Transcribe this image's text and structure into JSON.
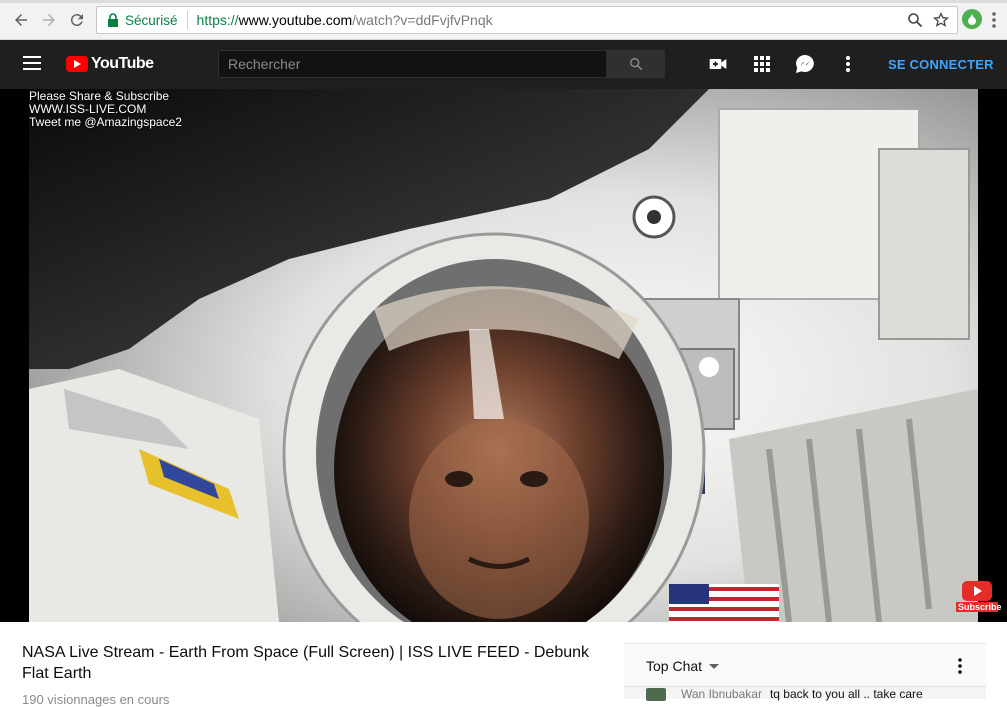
{
  "browser": {
    "secure_label": "Sécurisé",
    "url_scheme": "https://",
    "url_host": "www.youtube.com",
    "url_path": "/watch?v=ddFvjfvPnqk"
  },
  "masthead": {
    "logo_text": "YouTube",
    "search_placeholder": "Rechercher",
    "signin_label": "SE CONNECTER"
  },
  "player": {
    "overlay_lines": [
      "Please Share & Subscribe",
      "WWW.ISS-LIVE.COM",
      "Tweet me @Amazingspace2"
    ],
    "watermark_label": "Subscribe"
  },
  "video": {
    "title": "NASA Live Stream - Earth From Space (Full Screen) | ISS LIVE FEED - Debunk Flat Earth",
    "views": "190 visionnages en cours"
  },
  "chat": {
    "header": "Top Chat",
    "messages": [
      {
        "author": "Wan Ibnubakar",
        "text": "tq back to you all .. take care"
      }
    ]
  },
  "colors": {
    "masthead_bg": "#1f1f1f",
    "youtube_red": "#ff0000",
    "signin_blue": "#3ea6ff",
    "secure_green": "#0b8043"
  }
}
